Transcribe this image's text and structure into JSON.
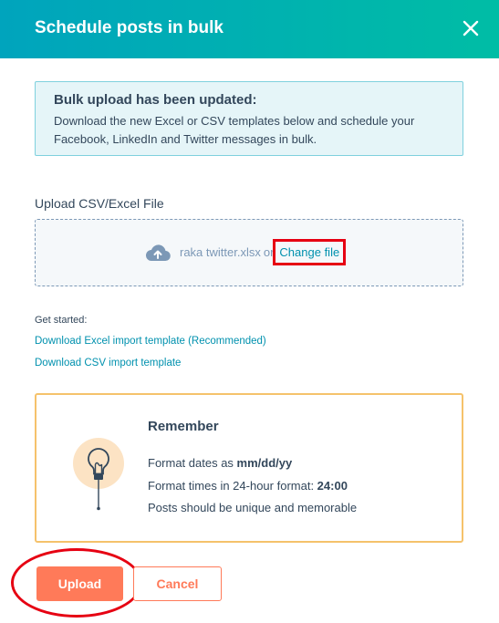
{
  "header": {
    "title": "Schedule posts in bulk",
    "close_icon": "close-icon"
  },
  "notice": {
    "title": "Bulk upload has been updated:",
    "body": "Download the new Excel or CSV templates below and schedule your Facebook, LinkedIn and Twitter messages in bulk."
  },
  "upload": {
    "label": "Upload CSV/Excel File",
    "icon": "cloud-upload-icon",
    "file_name": "raka twitter.xlsx",
    "or_text": "or",
    "change_file_label": "Change file"
  },
  "templates": {
    "intro": "Get started:",
    "excel_link": "Download Excel import template (Recommended)",
    "csv_link": "Download CSV import template"
  },
  "remember": {
    "icon": "lightbulb-icon",
    "title": "Remember",
    "date_prefix": "Format dates as ",
    "date_format": "mm/dd/yy",
    "time_prefix": "Format times in 24-hour format: ",
    "time_format": "24:00",
    "unique_note": "Posts should be unique and memorable"
  },
  "footer": {
    "upload_label": "Upload",
    "cancel_label": "Cancel"
  },
  "colors": {
    "header_gradient_start": "#00a4bd",
    "header_gradient_end": "#00bda5",
    "primary_button": "#ff7a59",
    "link": "#0091ae",
    "callout_border": "#f5c26b",
    "annotation_red": "#e60012"
  }
}
